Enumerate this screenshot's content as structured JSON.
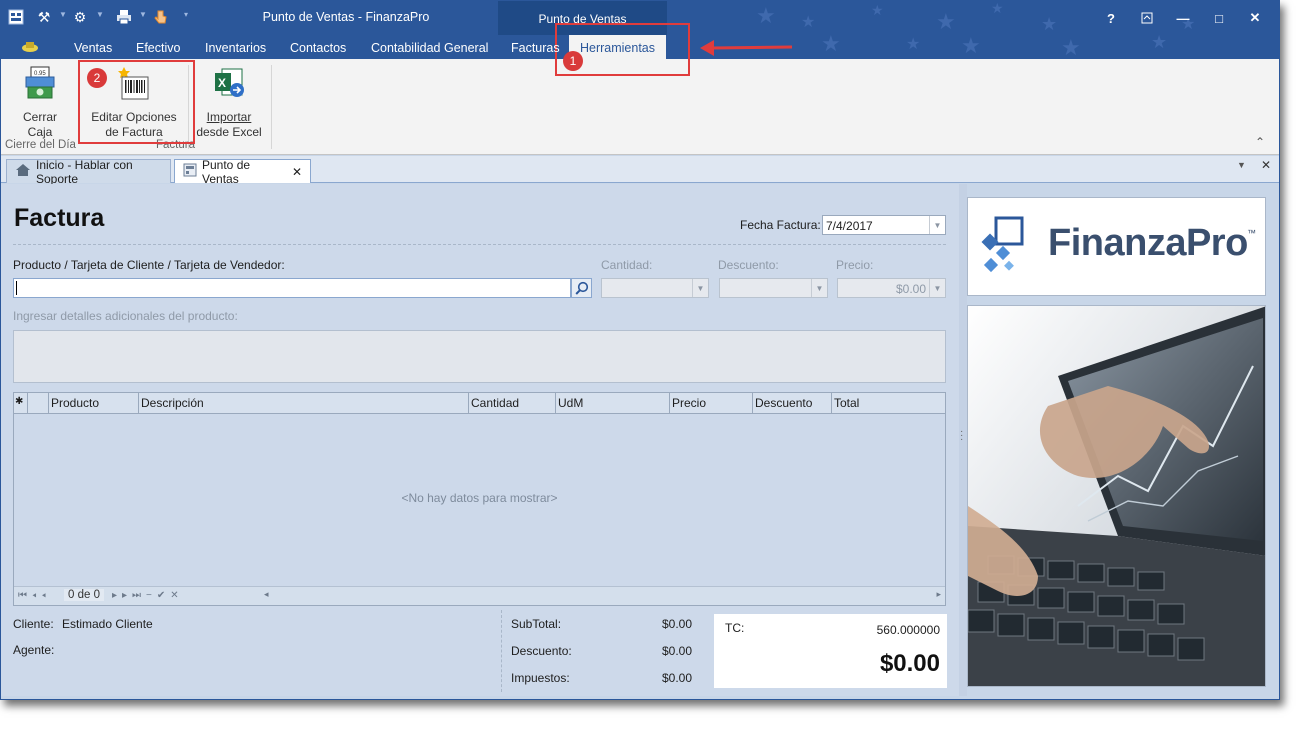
{
  "window": {
    "title": "Punto de Ventas - FinanzaPro",
    "context_group": "Punto de Ventas",
    "buttons": {
      "help": "?",
      "minimize": "—",
      "maximize": "□",
      "close": "✕"
    }
  },
  "ribbon_tabs": [
    "Ventas",
    "Efectivo",
    "Inventarios",
    "Contactos",
    "Contabilidad General",
    "Facturas",
    "Herramientas"
  ],
  "active_tab": "Herramientas",
  "ribbon": {
    "buttons": [
      {
        "label1": "Cerrar",
        "label2": "Caja",
        "icon": "cash-register-icon"
      },
      {
        "label1": "Editar Opciones",
        "label2": "de Factura",
        "icon": "barcode-invoice-icon"
      },
      {
        "label1": "Importar",
        "label2": "desde Excel",
        "icon": "excel-icon"
      }
    ],
    "groups": [
      "Cierre del Día",
      "Factura"
    ]
  },
  "annotations": {
    "one": "1",
    "two": "2"
  },
  "doc_tabs": [
    "Inicio - Hablar con Soporte",
    "Punto de Ventas"
  ],
  "invoice": {
    "title": "Factura",
    "date_label": "Fecha Factura:",
    "date_value": "7/4/2017",
    "product_label": "Producto / Tarjeta de Cliente / Tarjeta de Vendedor:",
    "product_value": "",
    "quantity_label": "Cantidad:",
    "discount_label": "Descuento:",
    "price_label": "Precio:",
    "price_value": "$0.00",
    "details_label": "Ingresar detalles adicionales del producto:",
    "grid": {
      "columns": [
        "Producto",
        "Descripción",
        "Cantidad",
        "UdM",
        "Precio",
        "Descuento",
        "Total"
      ],
      "empty_text": "<No hay datos para mostrar>",
      "pager": "0 de 0"
    },
    "client_label": "Cliente:",
    "client_value": "Estimado Cliente",
    "agent_label": "Agente:",
    "agent_value": "",
    "totals": [
      {
        "label": "SubTotal:",
        "value": "$0.00"
      },
      {
        "label": "Descuento:",
        "value": "$0.00"
      },
      {
        "label": "Impuestos:",
        "value": "$0.00"
      }
    ],
    "tc_label": "TC:",
    "tc_value": "560.000000",
    "grand_total": "$0.00"
  },
  "brand": {
    "name": "FinanzaPro",
    "tm": "™",
    "color": "#3a6fb5"
  }
}
